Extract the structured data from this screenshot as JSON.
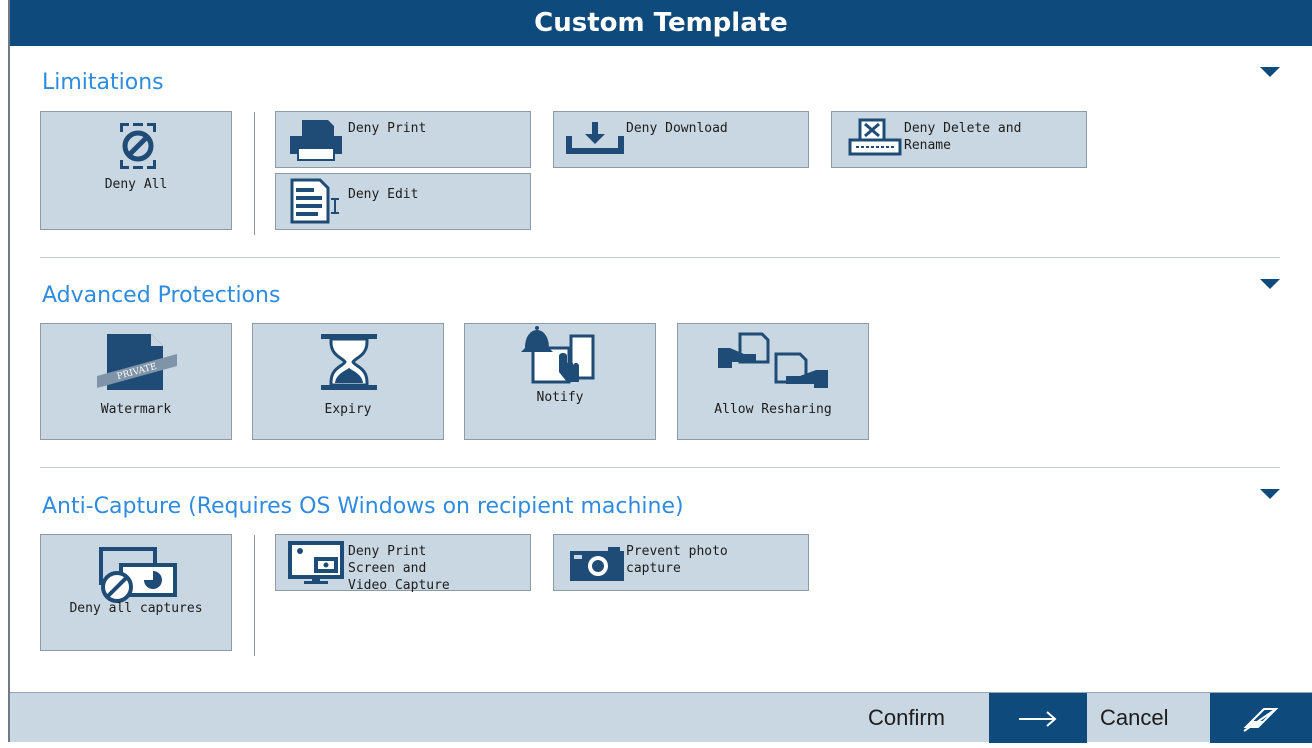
{
  "dialog": {
    "title": "Custom Template"
  },
  "sections": {
    "limitations": {
      "title": "Limitations",
      "deny_all": "Deny All",
      "deny_print": "Deny Print",
      "deny_download": "Deny Download",
      "deny_delete_1": "Deny Delete and",
      "deny_delete_2": "Rename",
      "deny_edit": "Deny Edit"
    },
    "advanced": {
      "title": "Advanced Protections",
      "watermark": "Watermark",
      "watermark_stamp": "PRIVATE",
      "expiry": "Expiry",
      "notify": "Notify",
      "allow_resharing": "Allow Resharing"
    },
    "anticapture": {
      "title": "Anti-Capture (Requires OS Windows on recipient machine)",
      "deny_all_captures": "Deny all captures",
      "deny_print_screen_1": "Deny Print",
      "deny_print_screen_2": "Screen and",
      "deny_print_screen_3": "Video Capture",
      "prevent_photo_1": "Prevent photo",
      "prevent_photo_2": "capture"
    }
  },
  "footer": {
    "confirm": "Confirm",
    "cancel": "Cancel"
  },
  "icons": {
    "collapse": "caret-down-icon",
    "confirm": "arrow-right-icon",
    "cancel": "eraser-icon"
  },
  "colors": {
    "accent": "#0f4a7c",
    "tile": "#c8d7e2",
    "section_title": "#2f8be0"
  }
}
